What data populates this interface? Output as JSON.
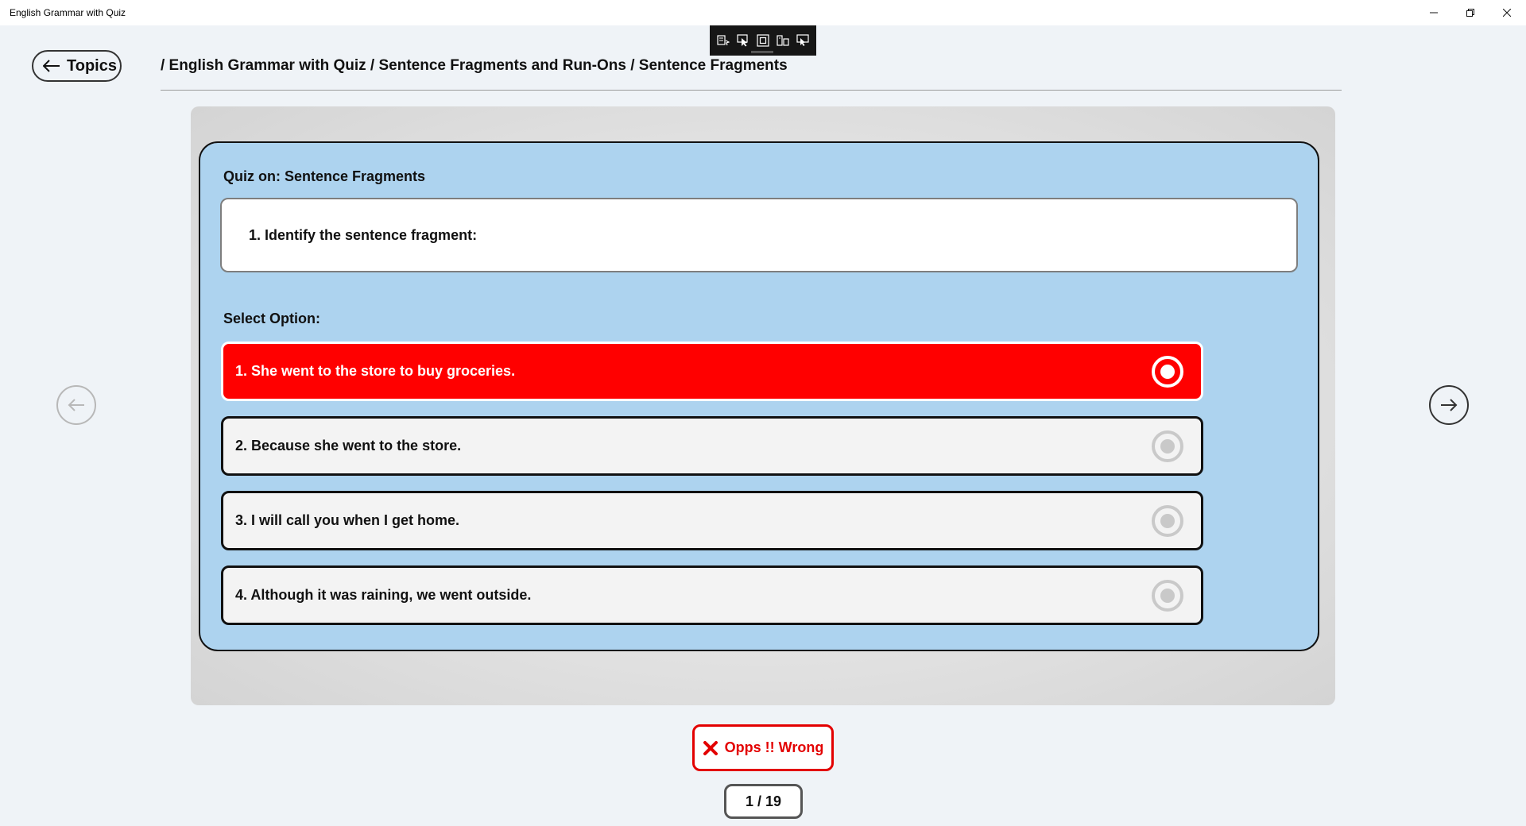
{
  "window": {
    "title": "English Grammar with Quiz",
    "controls": {
      "minimize": "minimize-icon",
      "maximize": "restore-icon",
      "close": "close-icon"
    }
  },
  "debug_toolbar": {
    "icons": [
      "live-visual-tree-icon",
      "select-element-icon",
      "display-layout-adorners-icon",
      "track-focus-icon",
      "hot-reload-icon"
    ]
  },
  "header": {
    "back_label": "Topics",
    "breadcrumb": "/ English Grammar with Quiz / Sentence Fragments and Run-Ons / Sentence Fragments"
  },
  "quiz": {
    "title": "Quiz on: Sentence Fragments",
    "question": "1.  Identify the sentence fragment:",
    "select_label": "Select Option:",
    "options": [
      {
        "label": "1. She went to the store to buy groceries.",
        "state": "wrong-selected"
      },
      {
        "label": "2. Because she went to the store.",
        "state": "unselected"
      },
      {
        "label": "3. I will call you when I get home.",
        "state": "unselected"
      },
      {
        "label": "4. Although it was raining, we went outside.",
        "state": "unselected"
      }
    ]
  },
  "feedback": {
    "text": "Opps !! Wrong",
    "icon": "cross-icon"
  },
  "counter": "1 / 19",
  "colors": {
    "panel_bg": "#add3ef",
    "wrong": "#ff0000",
    "feedback_text": "#e30000",
    "page_bg": "#eff3f7"
  }
}
